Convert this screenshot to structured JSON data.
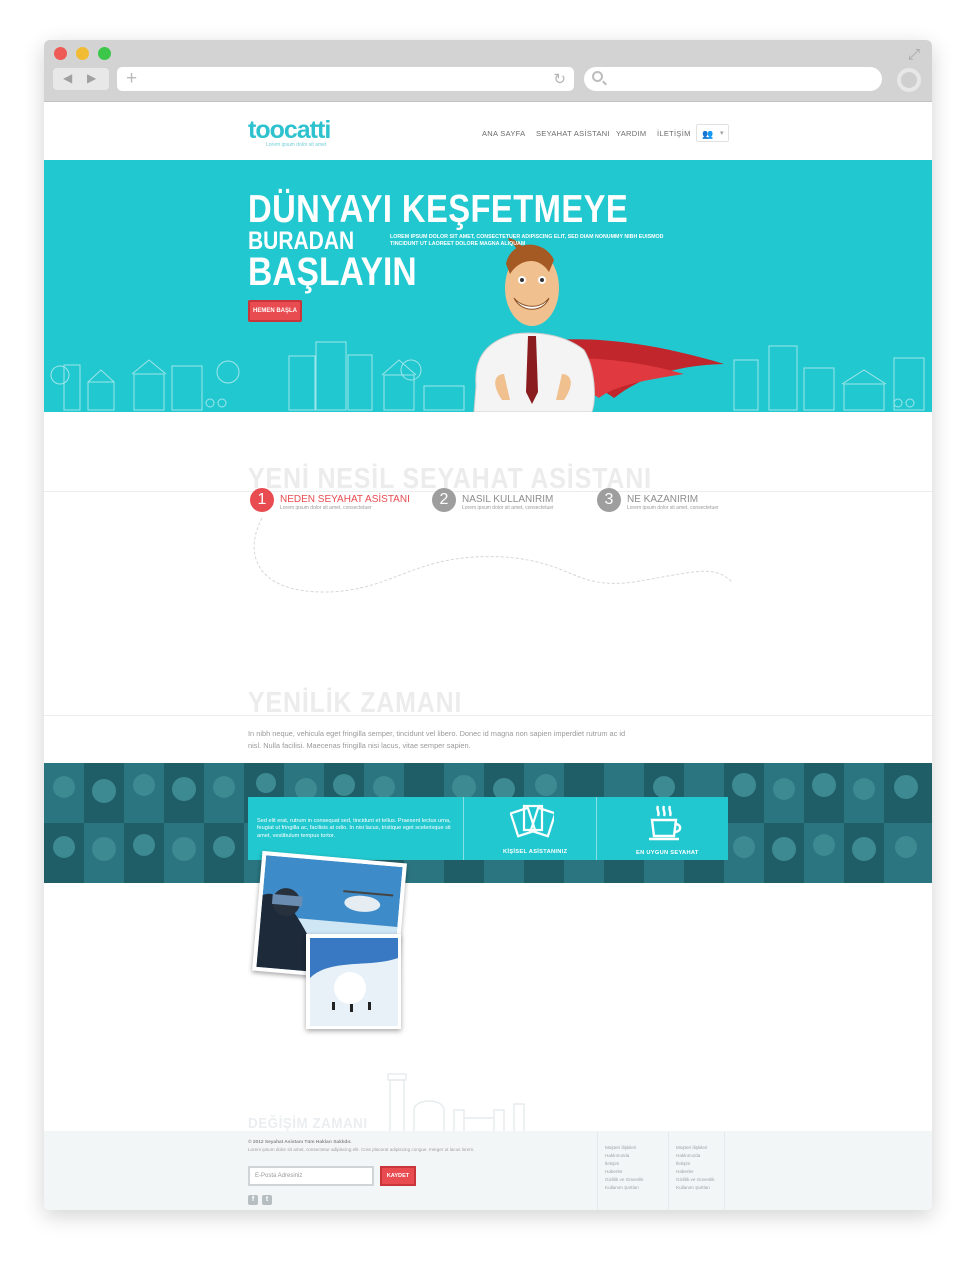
{
  "browser": {
    "back_icon": "◀",
    "forward_icon": "▶",
    "new_tab_icon": "+",
    "reload_icon": "↻"
  },
  "header": {
    "logo_text": "toocatti",
    "logo_tagline": "Lorem ipsum dolor sit amet",
    "nav": [
      "ANA SAYFA",
      "SEYAHAT ASİSTANI",
      "YARDIM",
      "İLETİŞİM"
    ]
  },
  "hero": {
    "line1": "DÜNYAYI KEŞFETMEYE",
    "line2": "BURADAN",
    "line3": "BAŞLAYIN",
    "subtitle": "LOREM IPSUM DOLOR SIT AMET, CONSECTETUER ADIPISCING ELIT, SED DIAM NONUMMY NIBH EUISMOD TINCIDUNT UT LAOREET DOLORE MAGNA ALIQUAM",
    "cta": "HEMEN BAŞLA"
  },
  "assistant": {
    "title": "YENİ NESİL SEYAHAT ASİSTANI",
    "steps": [
      {
        "num": "1",
        "title": "NEDEN SEYAHAT ASİSTANI",
        "sub": "Lorem ipsum dolor sit amet, consectetuer"
      },
      {
        "num": "2",
        "title": "NASIL KULLANIRIM",
        "sub": "Lorem ipsum dolor sit amet, consectetuer"
      },
      {
        "num": "3",
        "title": "NE KAZANIRIM",
        "sub": "Lorem ipsum dolor sit amet, consectetuer"
      }
    ]
  },
  "innovation": {
    "title": "YENİLİK ZAMANI",
    "text": "In nibh neque, vehicula eget fringilla semper, tincidunt vel libero. Donec id magna non sapien imperdiet rutrum ac id nisl. Nulla facilisi. Maecenas fringilla nisi lacus, vitae semper sapien."
  },
  "banner": {
    "text": "Sed elit erat, rutrum in consequat sed, tincidunt et tellus. Praesent lectus urna, feugiat ut fringilla ac, facilisis at odio. In nisi lacus, tristique eget scelerisque sit amet, vestibulum tempus tortor.",
    "feature1": "KİŞİSEL ASİSTANINIZ",
    "feature2": "EN UYGUN SEYAHAT"
  },
  "footer": {
    "title": "DEĞİŞİM ZAMANI",
    "copyright": "© 2012 Seyahat Asistanı Tüm Hakları Saklıdır.",
    "small": "Lorem ipsum dolor sit amet, consectetur adipiscing elit. Cras placerat adipiscing congue. Integer ut lacus lorem.",
    "email_placeholder": "E-Posta Adresiniz",
    "save": "KAYDET",
    "links1": [
      "Müşteri İlişkileri",
      "Hakkımızda",
      "İletişim",
      "Haberler",
      "Gizlilik ve Güvenlik",
      "Kullanım Şartları"
    ],
    "links2": [
      "Müşteri İlişkileri",
      "Hakkımızda",
      "İletişim",
      "Haberler",
      "Gizlilik ve Güvenlik",
      "Kullanım Şartları"
    ],
    "social": [
      "f",
      "t"
    ]
  },
  "colors": {
    "accent": "#22c8cf",
    "cta": "#e84b50",
    "step_active": "#e84b50",
    "step_inactive": "#9e9e9e"
  }
}
